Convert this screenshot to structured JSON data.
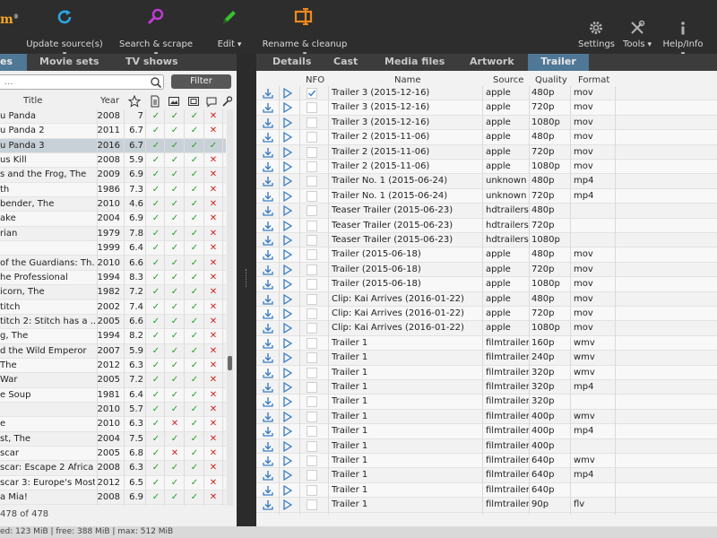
{
  "toolbar": {
    "logo_fragment": "m",
    "buttons": [
      {
        "label": "Update source(s)",
        "icon": "refresh-icon"
      },
      {
        "label": "Search & scrape",
        "icon": "search-scrape-icon"
      },
      {
        "label": "Edit",
        "icon": "pencil-icon"
      },
      {
        "label": "Rename & cleanup",
        "icon": "rename-icon"
      }
    ],
    "right_buttons": [
      {
        "label": "Settings",
        "icon": "gear-icon"
      },
      {
        "label": "Tools",
        "icon": "tools-icon"
      },
      {
        "label": "Help/Info",
        "icon": "info-icon"
      }
    ]
  },
  "left_panel": {
    "tabs": [
      "es",
      "Movie sets",
      "TV shows"
    ],
    "search": {
      "placeholder": "..."
    },
    "filter_label": "Filter",
    "columns": {
      "title": "Title",
      "year": "Year"
    },
    "movies": [
      {
        "title": "u Panda",
        "year": "2008",
        "rating": "7",
        "flags": [
          1,
          1,
          1,
          0
        ]
      },
      {
        "title": "u Panda 2",
        "year": "2011",
        "rating": "6.7",
        "flags": [
          1,
          1,
          1,
          0
        ]
      },
      {
        "title": "u Panda 3",
        "year": "2016",
        "rating": "6.7",
        "flags": [
          1,
          1,
          1,
          1
        ],
        "selected": true
      },
      {
        "title": "us Kill",
        "year": "2008",
        "rating": "5.9",
        "flags": [
          1,
          1,
          1,
          0
        ]
      },
      {
        "title": "s and the Frog, The",
        "year": "2009",
        "rating": "6.9",
        "flags": [
          1,
          1,
          1,
          0
        ]
      },
      {
        "title": "th",
        "year": "1986",
        "rating": "7.3",
        "flags": [
          1,
          1,
          1,
          0
        ]
      },
      {
        "title": "bender, The",
        "year": "2010",
        "rating": "4.6",
        "flags": [
          1,
          1,
          1,
          0
        ]
      },
      {
        "title": "ake",
        "year": "2004",
        "rating": "6.9",
        "flags": [
          1,
          1,
          1,
          0
        ]
      },
      {
        "title": "rian",
        "year": "1979",
        "rating": "7.8",
        "flags": [
          1,
          1,
          1,
          0
        ]
      },
      {
        "title": "",
        "year": "1999",
        "rating": "6.4",
        "flags": [
          1,
          1,
          1,
          0
        ]
      },
      {
        "title": " of the Guardians: Th...",
        "year": "2010",
        "rating": "6.6",
        "flags": [
          1,
          1,
          1,
          0
        ]
      },
      {
        "title": "he Professional",
        "year": "1994",
        "rating": "8.3",
        "flags": [
          1,
          1,
          1,
          0
        ]
      },
      {
        "title": "icorn, The",
        "year": "1982",
        "rating": "7.2",
        "flags": [
          1,
          1,
          1,
          0
        ]
      },
      {
        "title": "titch",
        "year": "2002",
        "rating": "7.4",
        "flags": [
          1,
          1,
          1,
          0
        ]
      },
      {
        "title": "titch 2: Stitch has a ...",
        "year": "2005",
        "rating": "6.6",
        "flags": [
          1,
          1,
          1,
          0
        ]
      },
      {
        "title": "g, The",
        "year": "1994",
        "rating": "8.2",
        "flags": [
          1,
          1,
          1,
          0
        ]
      },
      {
        "title": "d the Wild Emperor",
        "year": "2007",
        "rating": "5.9",
        "flags": [
          1,
          1,
          1,
          0
        ]
      },
      {
        "title": "The",
        "year": "2012",
        "rating": "6.3",
        "flags": [
          1,
          1,
          1,
          0
        ]
      },
      {
        "title": "War",
        "year": "2005",
        "rating": "7.2",
        "flags": [
          1,
          1,
          1,
          0
        ]
      },
      {
        "title": "e Soup",
        "year": "1981",
        "rating": "6.4",
        "flags": [
          1,
          1,
          1,
          0
        ]
      },
      {
        "title": "",
        "year": "2010",
        "rating": "5.7",
        "flags": [
          1,
          1,
          1,
          0
        ]
      },
      {
        "title": "e",
        "year": "2010",
        "rating": "6.3",
        "flags": [
          1,
          0,
          1,
          0
        ]
      },
      {
        "title": "st, The",
        "year": "2004",
        "rating": "7.5",
        "flags": [
          1,
          1,
          1,
          0
        ]
      },
      {
        "title": "scar",
        "year": "2005",
        "rating": "6.8",
        "flags": [
          1,
          0,
          1,
          0
        ]
      },
      {
        "title": "scar: Escape 2 Africa",
        "year": "2008",
        "rating": "6.3",
        "flags": [
          1,
          1,
          1,
          0
        ]
      },
      {
        "title": "scar 3: Europe's Most...",
        "year": "2012",
        "rating": "6.5",
        "flags": [
          1,
          1,
          1,
          0
        ]
      },
      {
        "title": "a Mia!",
        "year": "2008",
        "rating": "6.9",
        "flags": [
          1,
          1,
          1,
          0
        ]
      }
    ],
    "count_text": "478 of 478"
  },
  "right_panel": {
    "tabs": [
      "Details",
      "Cast",
      "Media files",
      "Artwork",
      "Trailer"
    ],
    "active_tab": "Trailer",
    "columns": {
      "nfo": "NFO",
      "name": "Name",
      "source": "Source",
      "quality": "Quality",
      "format": "Format"
    },
    "trailers": [
      {
        "name": "Trailer 3 (2015-12-16)",
        "source": "apple",
        "quality": "480p",
        "format": "mov",
        "nfo": true
      },
      {
        "name": "Trailer 3 (2015-12-16)",
        "source": "apple",
        "quality": "720p",
        "format": "mov"
      },
      {
        "name": "Trailer 3 (2015-12-16)",
        "source": "apple",
        "quality": "1080p",
        "format": "mov"
      },
      {
        "name": "Trailer 2 (2015-11-06)",
        "source": "apple",
        "quality": "480p",
        "format": "mov"
      },
      {
        "name": "Trailer 2 (2015-11-06)",
        "source": "apple",
        "quality": "720p",
        "format": "mov"
      },
      {
        "name": "Trailer 2 (2015-11-06)",
        "source": "apple",
        "quality": "1080p",
        "format": "mov"
      },
      {
        "name": "Trailer No. 1 (2015-06-24)",
        "source": "unknown",
        "quality": "480p",
        "format": "mp4"
      },
      {
        "name": "Trailer No. 1 (2015-06-24)",
        "source": "unknown",
        "quality": "720p",
        "format": "mp4"
      },
      {
        "name": "Teaser Trailer (2015-06-23)",
        "source": "hdtrailers",
        "quality": "480p",
        "format": ""
      },
      {
        "name": "Teaser Trailer (2015-06-23)",
        "source": "hdtrailers",
        "quality": "720p",
        "format": ""
      },
      {
        "name": "Teaser Trailer (2015-06-23)",
        "source": "hdtrailers",
        "quality": "1080p",
        "format": ""
      },
      {
        "name": "Trailer (2015-06-18)",
        "source": "apple",
        "quality": "480p",
        "format": "mov"
      },
      {
        "name": "Trailer (2015-06-18)",
        "source": "apple",
        "quality": "720p",
        "format": "mov"
      },
      {
        "name": "Trailer (2015-06-18)",
        "source": "apple",
        "quality": "1080p",
        "format": "mov"
      },
      {
        "name": "Clip: Kai Arrives (2016-01-22)",
        "source": "apple",
        "quality": "480p",
        "format": "mov"
      },
      {
        "name": "Clip: Kai Arrives (2016-01-22)",
        "source": "apple",
        "quality": "720p",
        "format": "mov"
      },
      {
        "name": "Clip: Kai Arrives (2016-01-22)",
        "source": "apple",
        "quality": "1080p",
        "format": "mov"
      },
      {
        "name": "Trailer 1",
        "source": "filmtrailer",
        "quality": "160p",
        "format": "wmv"
      },
      {
        "name": "Trailer 1",
        "source": "filmtrailer",
        "quality": "240p",
        "format": "wmv"
      },
      {
        "name": "Trailer 1",
        "source": "filmtrailer",
        "quality": "320p",
        "format": "wmv"
      },
      {
        "name": "Trailer 1",
        "source": "filmtrailer",
        "quality": "320p",
        "format": "mp4"
      },
      {
        "name": "Trailer 1",
        "source": "filmtrailer",
        "quality": "320p",
        "format": ""
      },
      {
        "name": "Trailer 1",
        "source": "filmtrailer",
        "quality": "400p",
        "format": "wmv"
      },
      {
        "name": "Trailer 1",
        "source": "filmtrailer",
        "quality": "400p",
        "format": "mp4"
      },
      {
        "name": "Trailer 1",
        "source": "filmtrailer",
        "quality": "400p",
        "format": ""
      },
      {
        "name": "Trailer 1",
        "source": "filmtrailer",
        "quality": "640p",
        "format": "wmv"
      },
      {
        "name": "Trailer 1",
        "source": "filmtrailer",
        "quality": "640p",
        "format": "mp4"
      },
      {
        "name": "Trailer 1",
        "source": "filmtrailer",
        "quality": "640p",
        "format": ""
      },
      {
        "name": "Trailer 1",
        "source": "filmtrailer",
        "quality": "90p",
        "format": "flv"
      }
    ]
  },
  "statusbar": {
    "text": "ed: 123 MiB  |  free: 388 MiB  |  max: 512 MiB"
  },
  "colors": {
    "accent": "#4f7796",
    "ok": "#22a022",
    "error": "#d21f1f",
    "toolbar_bg": "#2d2d2d"
  }
}
